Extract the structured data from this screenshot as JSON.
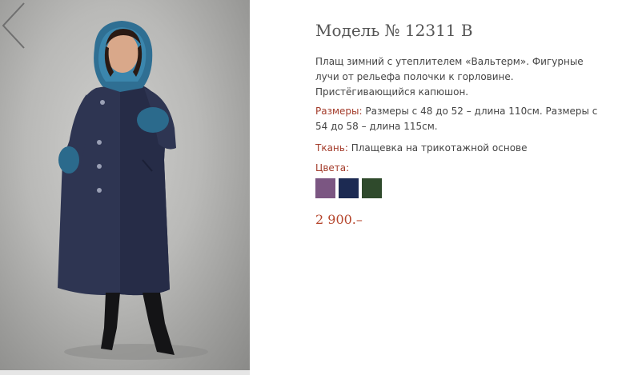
{
  "product": {
    "title": "Модель № 12311 В",
    "description": "Плащ зимний с утеплителем «Вальтерм». Фигурные лучи от рельефа полочки к горловине. Пристёгивающийся капюшон.",
    "sizes_label": "Размеры:",
    "sizes_value": " Размеры с 48 до 52 – длина 110см. Размеры с 54 до 58 – длина 115см.",
    "fabric_label": "Ткань:",
    "fabric_value": " Плащевка на трикотажной основе",
    "colors_label": "Цвета:",
    "colors": [
      {
        "name": "purple-swatch",
        "hex": "#7b5682"
      },
      {
        "name": "navy-swatch",
        "hex": "#1c2a52"
      },
      {
        "name": "dark-green-swatch",
        "hex": "#2f4a2c"
      }
    ],
    "price": "2 900.–"
  },
  "nav": {
    "prev_icon": "chevron-left-icon"
  },
  "image": {
    "subject": "model-photo"
  }
}
